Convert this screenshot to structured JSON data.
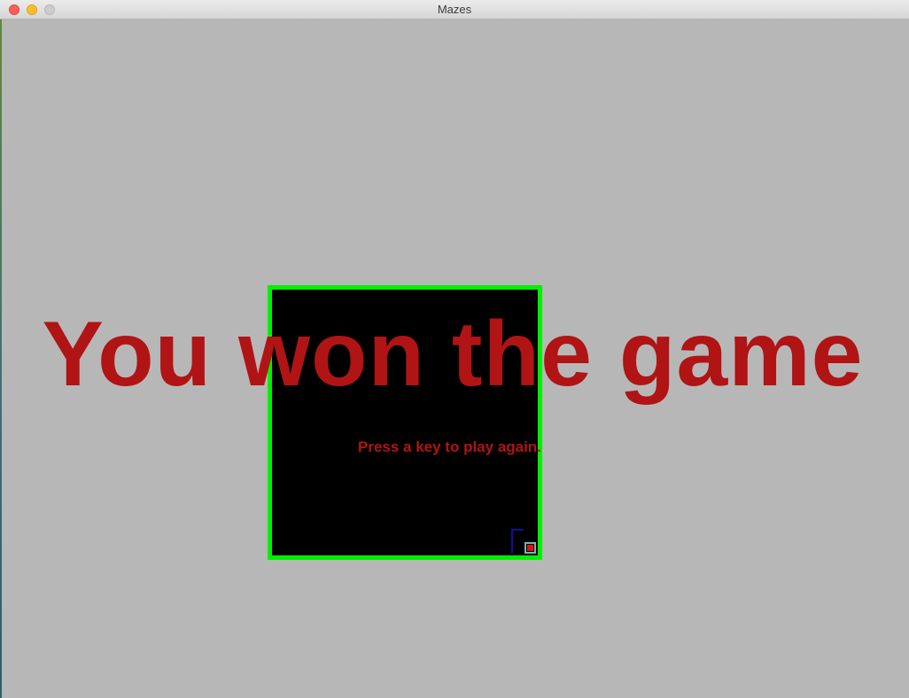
{
  "window": {
    "title": "Mazes"
  },
  "game": {
    "status": "won",
    "headline": "You won the game",
    "prompt": "Press a key to play again."
  },
  "colors": {
    "background": "#b7b7b7",
    "maze_border": "#00f000",
    "maze_floor": "#000000",
    "wall": "#1010a0",
    "goal": "#6fb6b6",
    "player": "#e01010",
    "message_text": "#b01414"
  },
  "icons": {
    "close": "close-icon",
    "minimize": "minimize-icon",
    "zoom": "zoom-icon"
  }
}
